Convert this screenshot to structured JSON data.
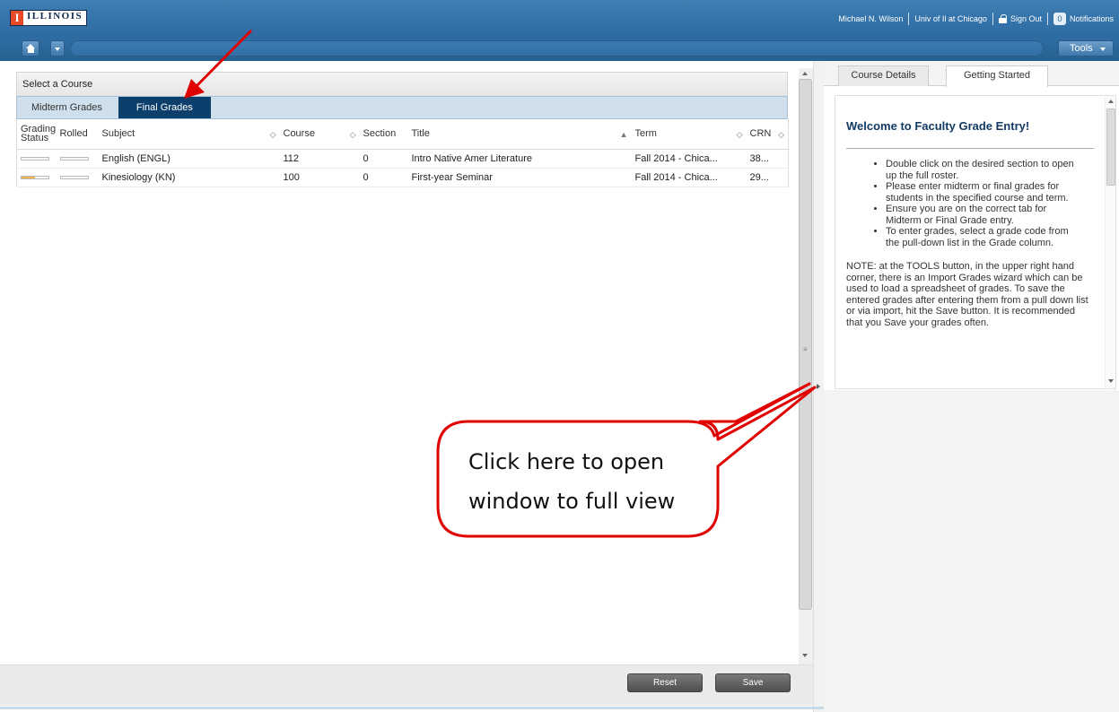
{
  "header": {
    "logo_letter": "I",
    "logo_text": "ILLINOIS",
    "user_name": "Michael N. Wilson",
    "campus": "Univ of Il at Chicago",
    "sign_out": "Sign Out",
    "notif_count": "0",
    "notifications": "Notifications"
  },
  "toolbar": {
    "tools_label": "Tools"
  },
  "left_panel": {
    "title": "Select a Course",
    "tabs": [
      {
        "label": "Midterm Grades"
      },
      {
        "label": "Final Grades"
      }
    ],
    "columns": {
      "grading_status_1": "Grading",
      "grading_status_2": "Status",
      "rolled": "Rolled",
      "subject": "Subject",
      "course": "Course",
      "section": "Section",
      "title": "Title",
      "term": "Term",
      "crn": "CRN"
    },
    "rows": [
      {
        "progress": 0,
        "subject": "English (ENGL)",
        "course": "112",
        "section": "0",
        "title": "Intro Native Amer Literature",
        "term": "Fall 2014 - Chica...",
        "crn": "38..."
      },
      {
        "progress": 0.5,
        "subject": "Kinesiology (KN)",
        "course": "100",
        "section": "0",
        "title": "First-year Seminar",
        "term": "Fall 2014 - Chica...",
        "crn": "29..."
      }
    ]
  },
  "footer": {
    "reset_label": "Reset",
    "save_label": "Save"
  },
  "right_panel": {
    "tabs": [
      {
        "label": "Course Details"
      },
      {
        "label": "Getting Started"
      }
    ],
    "welcome_title": "Welcome to Faculty Grade Entry!",
    "bullets": [
      "Double click on the desired section to open up the full roster.",
      "Please enter midterm or final grades for students in the specified course and term.",
      "Ensure you are on the correct tab for Midterm or Final Grade entry.",
      "To enter grades, select a grade code from the pull-down list in the Grade column."
    ],
    "note": "NOTE: at the TOOLS button, in the upper right hand corner, there is an Import Grades wizard which can be used to load a spreadsheet of grades. To save the entered grades after entering them from a pull down list or via import, hit the Save button. It is recommended that you Save your grades often."
  },
  "annotation": {
    "callout_line1": "Click here to open",
    "callout_line2": "window to full view",
    "callout_color": "#e00000"
  },
  "colors": {
    "header_blue": "#2c6aa1",
    "active_tab": "#0c3f6b",
    "progress_fill": "#f0b54a"
  }
}
